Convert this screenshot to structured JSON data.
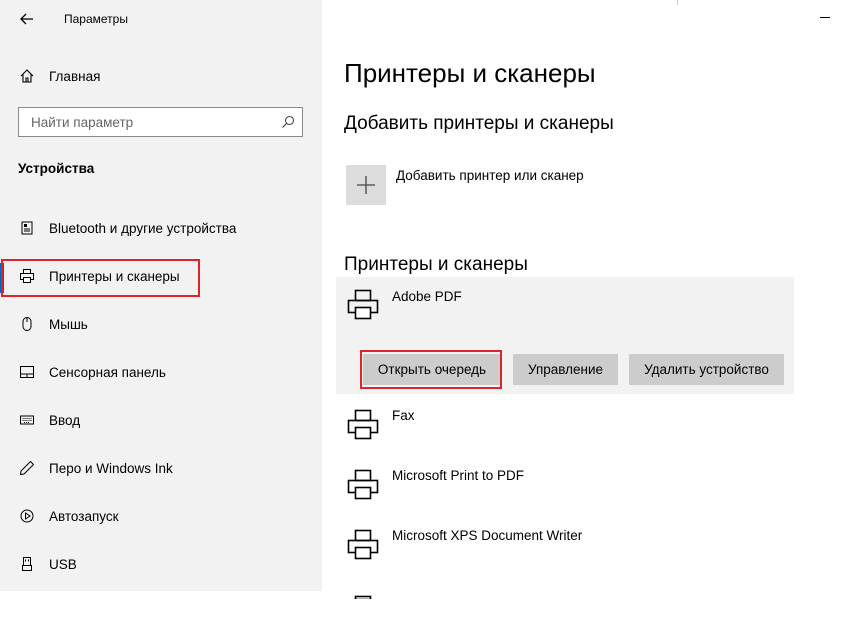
{
  "window": {
    "title": "Параметры"
  },
  "sidebar": {
    "home_label": "Главная",
    "search_placeholder": "Найти параметр",
    "section_title": "Устройства",
    "items": [
      {
        "label": "Bluetooth и другие устройства",
        "icon": "bluetooth-devices-icon"
      },
      {
        "label": "Принтеры и сканеры",
        "icon": "printer-icon",
        "selected": true
      },
      {
        "label": "Мышь",
        "icon": "mouse-icon"
      },
      {
        "label": "Сенсорная панель",
        "icon": "touchpad-icon"
      },
      {
        "label": "Ввод",
        "icon": "keyboard-icon"
      },
      {
        "label": "Перо и Windows Ink",
        "icon": "pen-icon"
      },
      {
        "label": "Автозапуск",
        "icon": "autoplay-icon"
      },
      {
        "label": "USB",
        "icon": "usb-icon"
      }
    ]
  },
  "main": {
    "page_title": "Принтеры и сканеры",
    "add_section_title": "Добавить принтеры и сканеры",
    "add_label": "Добавить принтер или сканер",
    "printers_section_title": "Принтеры и сканеры",
    "printers": [
      {
        "name": "Adobe PDF",
        "selected": true
      },
      {
        "name": "Fax"
      },
      {
        "name": "Microsoft Print to PDF"
      },
      {
        "name": "Microsoft XPS Document Writer"
      }
    ],
    "actions": {
      "open_queue": "Открыть очередь",
      "manage": "Управление",
      "remove": "Удалить устройство"
    }
  },
  "colors": {
    "accent": "#0067c0",
    "highlight": "#e0242b",
    "sidebar_bg": "#f2f2f2",
    "button_bg": "#cccccc"
  }
}
